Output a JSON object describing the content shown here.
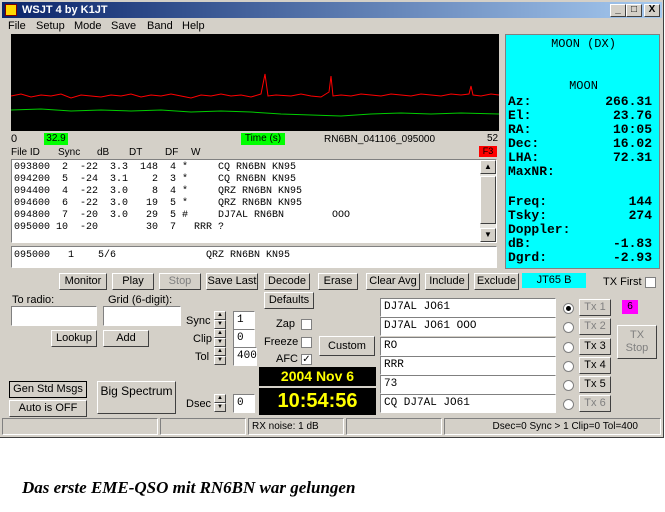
{
  "window": {
    "title": "WSJT 4   by K1JT",
    "min_label": "_",
    "max_label": "□",
    "close_label": "X"
  },
  "menu": [
    "File",
    "Setup",
    "Mode",
    "Save",
    "Band",
    "Help"
  ],
  "spectrum": {
    "scale_left": "0",
    "sync_value": "32.9",
    "time_label": "Time (s)",
    "filename": "RN6BN_041106_095000",
    "scale_right": "52",
    "f3_label": "F3"
  },
  "moon_panel": {
    "header": "MOON (DX)",
    "title": "MOON",
    "rows": [
      {
        "k": "Az:",
        "v": "266.31"
      },
      {
        "k": "El:",
        "v": "23.76"
      },
      {
        "k": "RA:",
        "v": "10:05"
      },
      {
        "k": "Dec:",
        "v": "16.02"
      },
      {
        "k": "LHA:",
        "v": "72.31"
      },
      {
        "k": "MaxNR:",
        "v": ""
      },
      {
        "k": "Freq:",
        "v": "144"
      },
      {
        "k": "Tsky:",
        "v": "274"
      },
      {
        "k": "Doppler:",
        "v": ""
      },
      {
        "k": "dB:",
        "v": "-1.83"
      },
      {
        "k": "Dgrd:",
        "v": "-2.93"
      }
    ]
  },
  "decode_table": {
    "headers": {
      "fileid": "File ID",
      "sync": "Sync",
      "db": "dB",
      "dt": "DT",
      "df": "DF",
      "w": "W"
    },
    "rows": [
      "093800  2  -22  3.3  148  4 *     CQ RN6BN KN95",
      "094200  5  -24  3.1    2  3 *     CQ RN6BN KN95",
      "094400  4  -22  3.0    8  4 *     QRZ RN6BN KN95",
      "094600  6  -22  3.0   19  5 *     QRZ RN6BN KN95",
      "094800  7  -20  3.0   29  5 #     DJ7AL RN6BN        OOO",
      "095000 10  -20        30  7   RRR ?"
    ],
    "avg_line": "095000   1    5/6               QRZ RN6BN KN95"
  },
  "buttons": {
    "monitor": "Monitor",
    "play": "Play",
    "stop": "Stop",
    "save_last": "Save Last",
    "decode": "Decode",
    "erase": "Erase",
    "clear_avg": "Clear Avg",
    "include": "Include",
    "exclude": "Exclude",
    "mode": "JT65 B",
    "tx_first": "TX First",
    "defaults": "Defaults",
    "lookup": "Lookup",
    "add": "Add",
    "custom": "Custom",
    "gen_std": "Gen Std Msgs",
    "auto": "Auto is OFF",
    "big_spectrum": "Big Spectrum",
    "tx_stop": "TX Stop"
  },
  "left_panel": {
    "to_radio_label": "To radio:",
    "grid_label": "Grid (6-digit):",
    "to_radio_value": "",
    "grid_value": ""
  },
  "controls": {
    "sync_label": "Sync",
    "sync_value": "1",
    "clip_label": "Clip",
    "clip_value": "0",
    "tol_label": "Tol",
    "tol_value": "400",
    "dsec_label": "Dsec",
    "dsec_value": "0",
    "zap_label": "Zap",
    "freeze_label": "Freeze",
    "afc_label": "AFC",
    "afc_check": "✓"
  },
  "clock": {
    "date": "2004 Nov 6",
    "time": "10:54:56"
  },
  "tx_messages": [
    {
      "text": "DJ7AL JO61",
      "btn": "Tx 1",
      "selected": true,
      "enabled": false
    },
    {
      "text": "DJ7AL JO61 OOO",
      "btn": "Tx 2",
      "selected": false,
      "enabled": false
    },
    {
      "text": "RO",
      "btn": "Tx 3",
      "selected": false,
      "enabled": true
    },
    {
      "text": "RRR",
      "btn": "Tx 4",
      "selected": false,
      "enabled": true
    },
    {
      "text": "73",
      "btn": "Tx 5",
      "selected": false,
      "enabled": true
    },
    {
      "text": "CQ DJ7AL JO61",
      "btn": "Tx 6",
      "selected": false,
      "enabled": false
    }
  ],
  "magenta_indicator": "6",
  "statusbar": {
    "rx_noise": "RX noise: 1 dB",
    "info": "Dsec=0  Sync > 1  Clip=0  Tol=400"
  },
  "caption": "Das erste EME-QSO mit RN6BN war gelungen",
  "colors": {
    "moon_bg": "#00ffff",
    "spectrum_bg": "#000000",
    "clock_bg": "#000000",
    "clock_fg": "#ffff00",
    "sync_bg": "#00ff00",
    "f3_bg": "#ff0000",
    "mode_bg": "#00ffff",
    "magenta": "#ff00ff"
  }
}
